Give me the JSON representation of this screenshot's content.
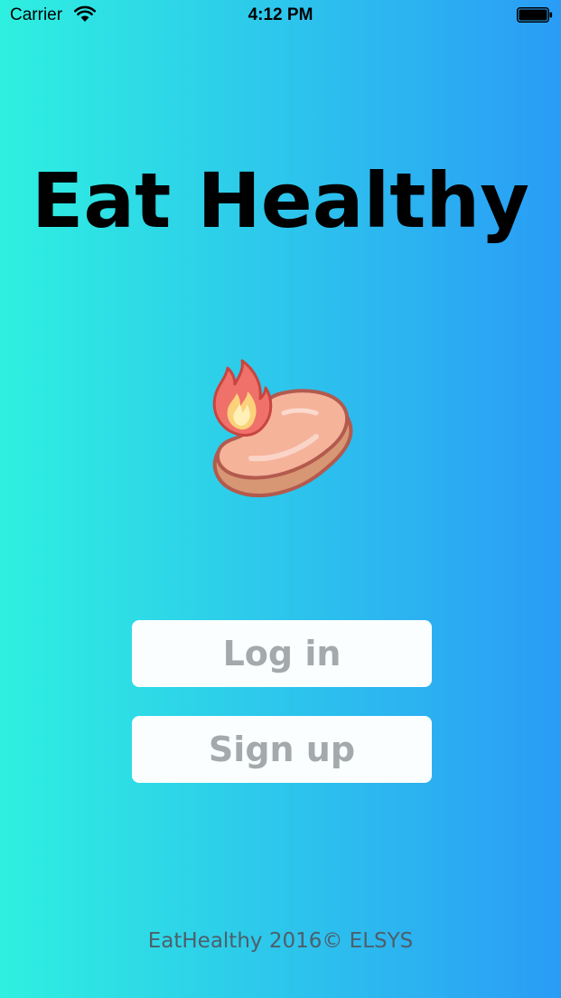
{
  "status_bar": {
    "carrier": "Carrier",
    "time": "4:12 PM",
    "wifi_icon": "wifi-icon",
    "battery_icon": "battery-icon"
  },
  "header": {
    "title": "Eat Healthy"
  },
  "logo": {
    "icon": "flaming-steak-icon"
  },
  "actions": {
    "login_label": "Log in",
    "signup_label": "Sign up"
  },
  "footer": {
    "text": "EatHealthy 2016© ELSYS"
  },
  "colors": {
    "gradient_start": "#2ef0e0",
    "gradient_end": "#2a9cf6",
    "button_bg": "#fafeff",
    "button_text": "#a4a9ab",
    "footer_text": "#4d5f6a"
  }
}
